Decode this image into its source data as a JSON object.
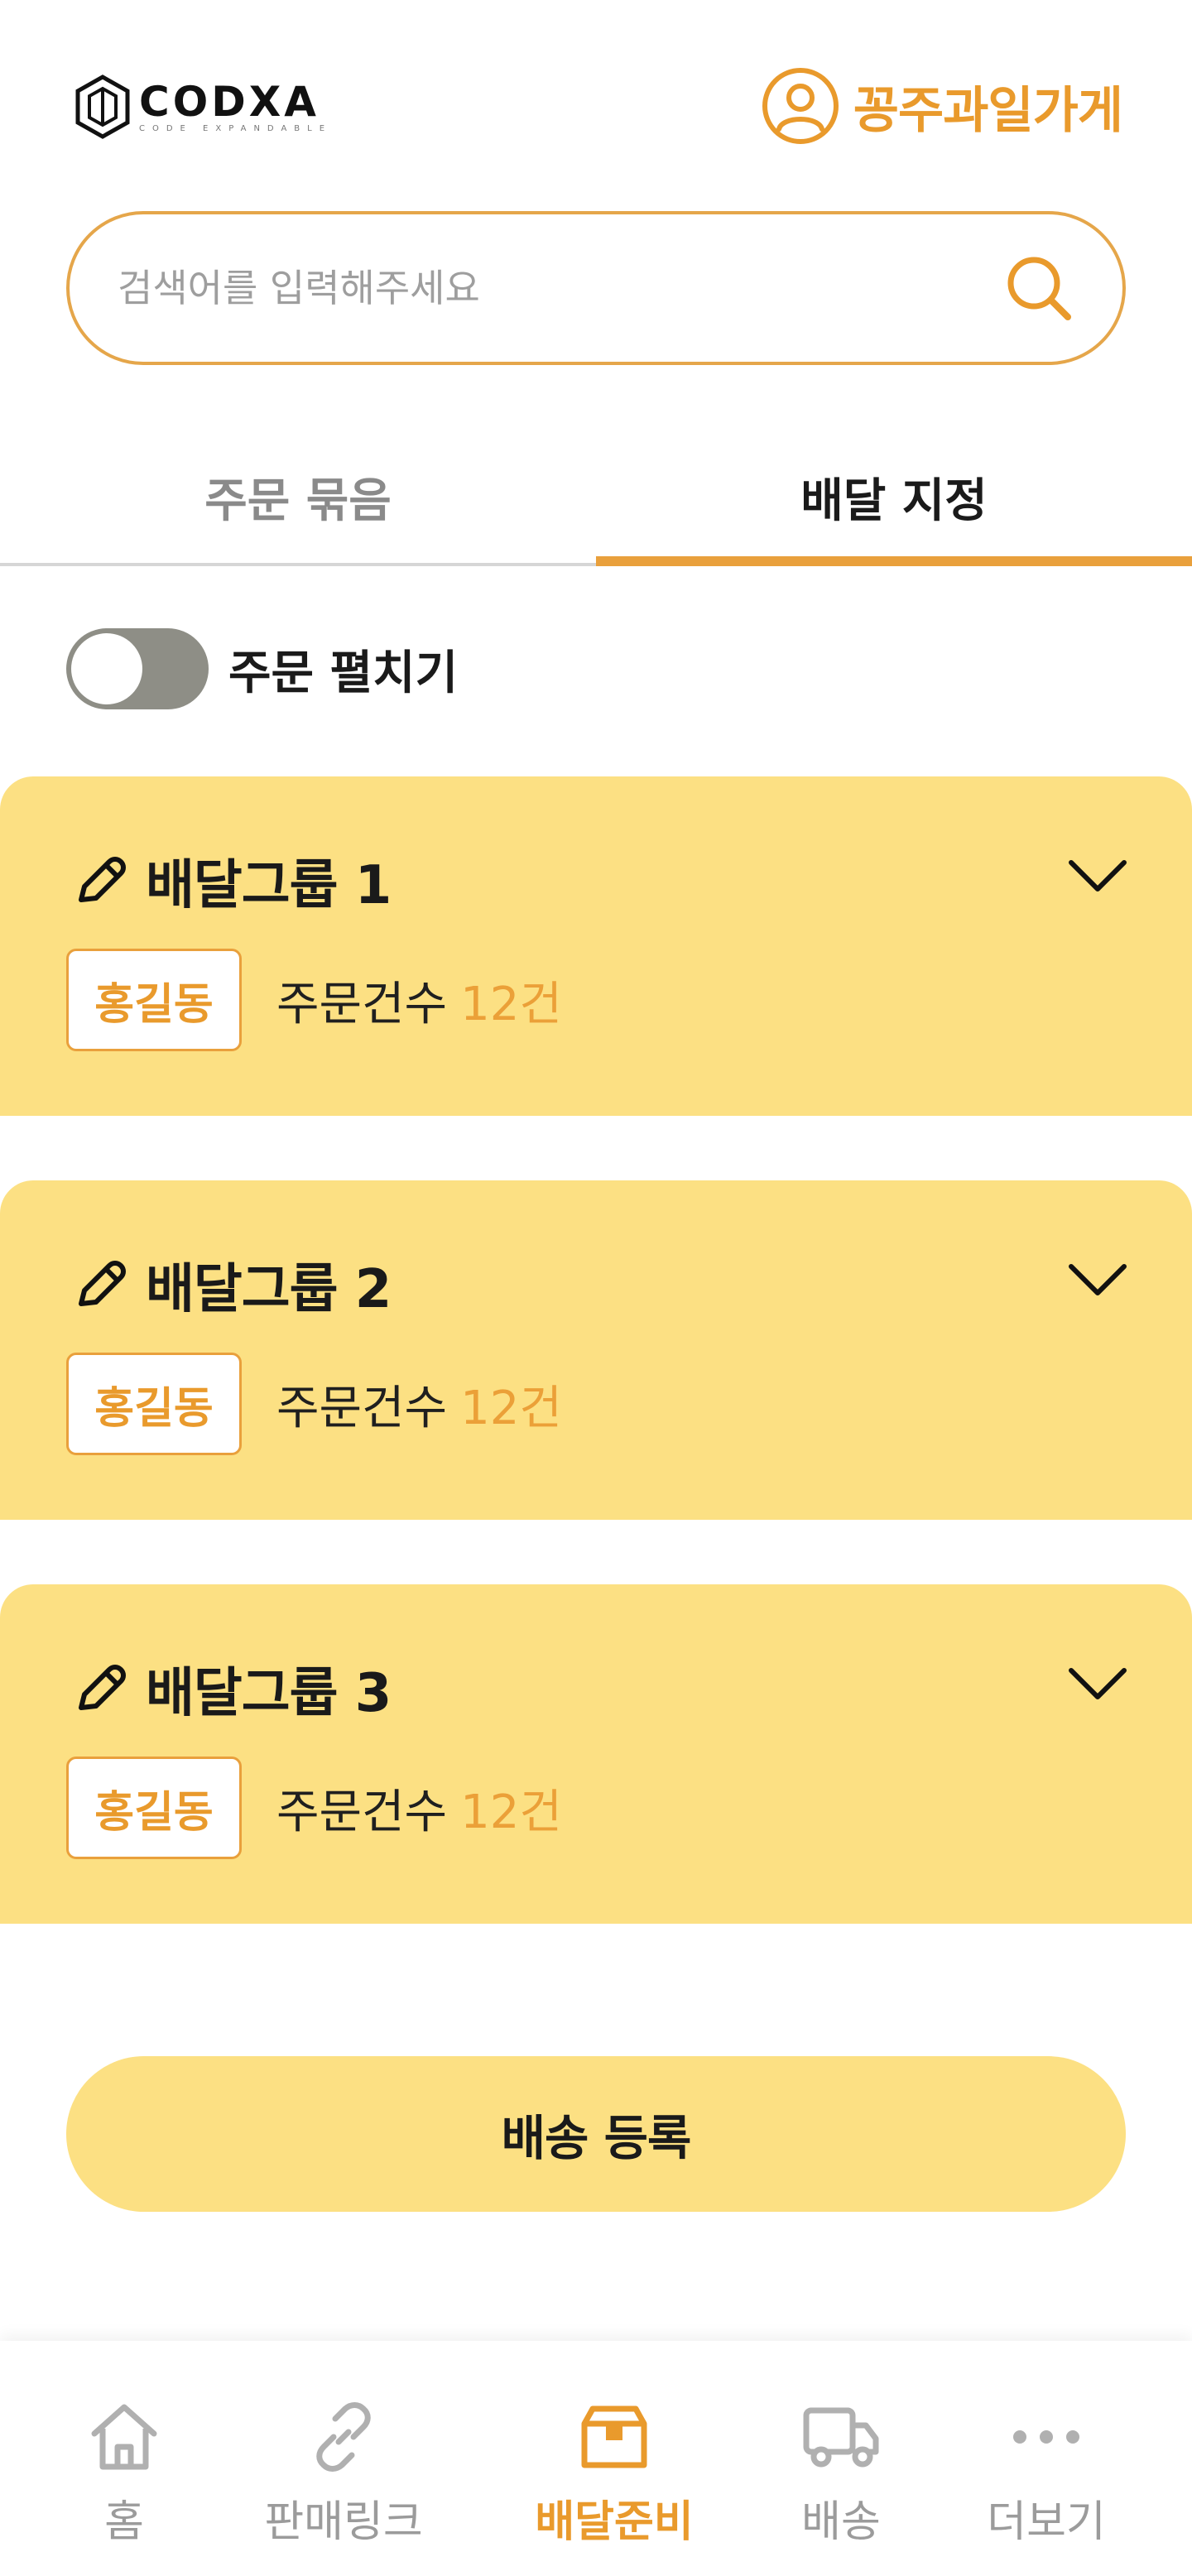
{
  "header": {
    "logo_text": "CODXA",
    "logo_subtext": "CODE EXPANDABLE",
    "store_name": "꽁주과일가게"
  },
  "search": {
    "placeholder": "검색어를 입력해주세요"
  },
  "tabs": [
    {
      "label": "주문 묶음",
      "active": false
    },
    {
      "label": "배달 지정",
      "active": true
    }
  ],
  "toggle": {
    "label": "주문 펼치기",
    "on": false
  },
  "groups": [
    {
      "title": "배달그룹 1",
      "tag": "홍길동",
      "order_label": "주문건수",
      "order_count": "12건"
    },
    {
      "title": "배달그룹 2",
      "tag": "홍길동",
      "order_label": "주문건수",
      "order_count": "12건"
    },
    {
      "title": "배달그룹 3",
      "tag": "홍길동",
      "order_label": "주문건수",
      "order_count": "12건"
    }
  ],
  "cta": {
    "label": "배송 등록"
  },
  "bottom_nav": [
    {
      "label": "홈",
      "icon": "home-icon",
      "active": false
    },
    {
      "label": "판매링크",
      "icon": "link-icon",
      "active": false
    },
    {
      "label": "배달준비",
      "icon": "box-icon",
      "active": true
    },
    {
      "label": "배송",
      "icon": "truck-icon",
      "active": false
    },
    {
      "label": "더보기",
      "icon": "more-icon",
      "active": false
    }
  ],
  "colors": {
    "accent": "#e99a2c",
    "card_background": "#fce083",
    "toggle_off": "#8e8e86",
    "inactive_text": "#9b9b9b"
  }
}
